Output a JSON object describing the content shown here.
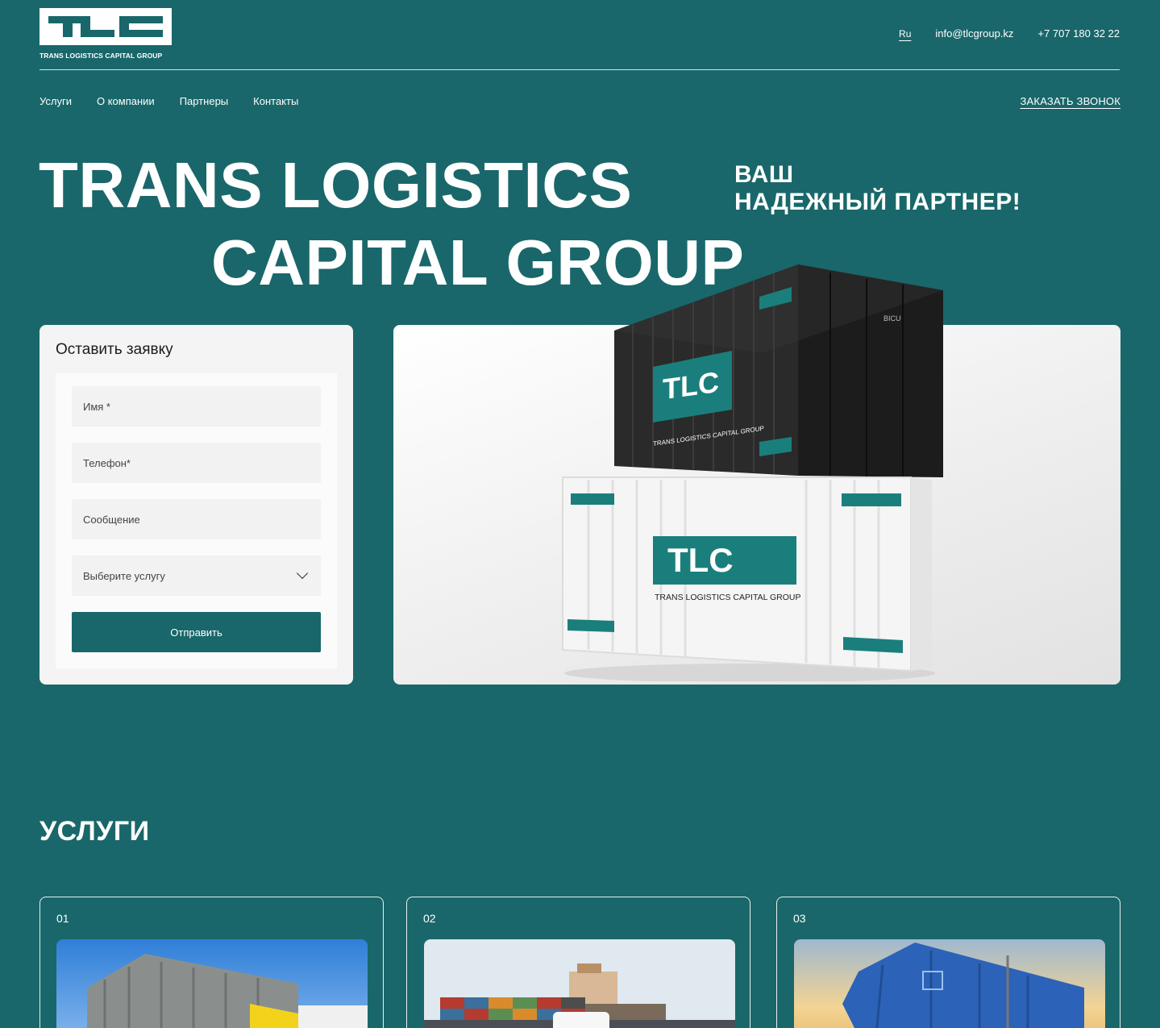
{
  "header": {
    "logo_text": "TLC",
    "logo_caption": "TRANS LOGISTICS CAPITAL GROUP",
    "lang": "Ru",
    "email": "info@tlcgroup.kz",
    "phone": "+7 707 180 32 22"
  },
  "nav": {
    "items": [
      "Услуги",
      "О компании",
      "Партнеры",
      "Контакты"
    ],
    "callback": "ЗАКАЗАТЬ ЗВОНОК"
  },
  "hero": {
    "line1": "TRANS LOGISTICS",
    "line2": "CAPITAL GROUP",
    "tagline1": "ВАШ",
    "tagline2": "НАДЕЖНЫЙ ПАРТНЕР!"
  },
  "form": {
    "title": "Оставить заявку",
    "name_placeholder": "Имя *",
    "phone_placeholder": "Телефон*",
    "message_placeholder": "Сообщение",
    "service_select": "Выберите услугу",
    "submit": "Отправить"
  },
  "containers": {
    "logo": "TLC",
    "caption": "TRANS LOGISTICS CAPITAL GROUP",
    "code_black": "BICU",
    "colors": {
      "black": "#1f1f1f",
      "white": "#f5f5f5",
      "accent": "#1a7f7c"
    }
  },
  "services": {
    "title": "УСЛУГИ",
    "cards": [
      {
        "number": "01",
        "image": "rail-freight-car"
      },
      {
        "number": "02",
        "image": "container-ship-truck"
      },
      {
        "number": "03",
        "image": "blue-hopper-car"
      }
    ]
  },
  "colors": {
    "background": "#19676a",
    "accent": "#19676a",
    "text": "#ffffff"
  }
}
